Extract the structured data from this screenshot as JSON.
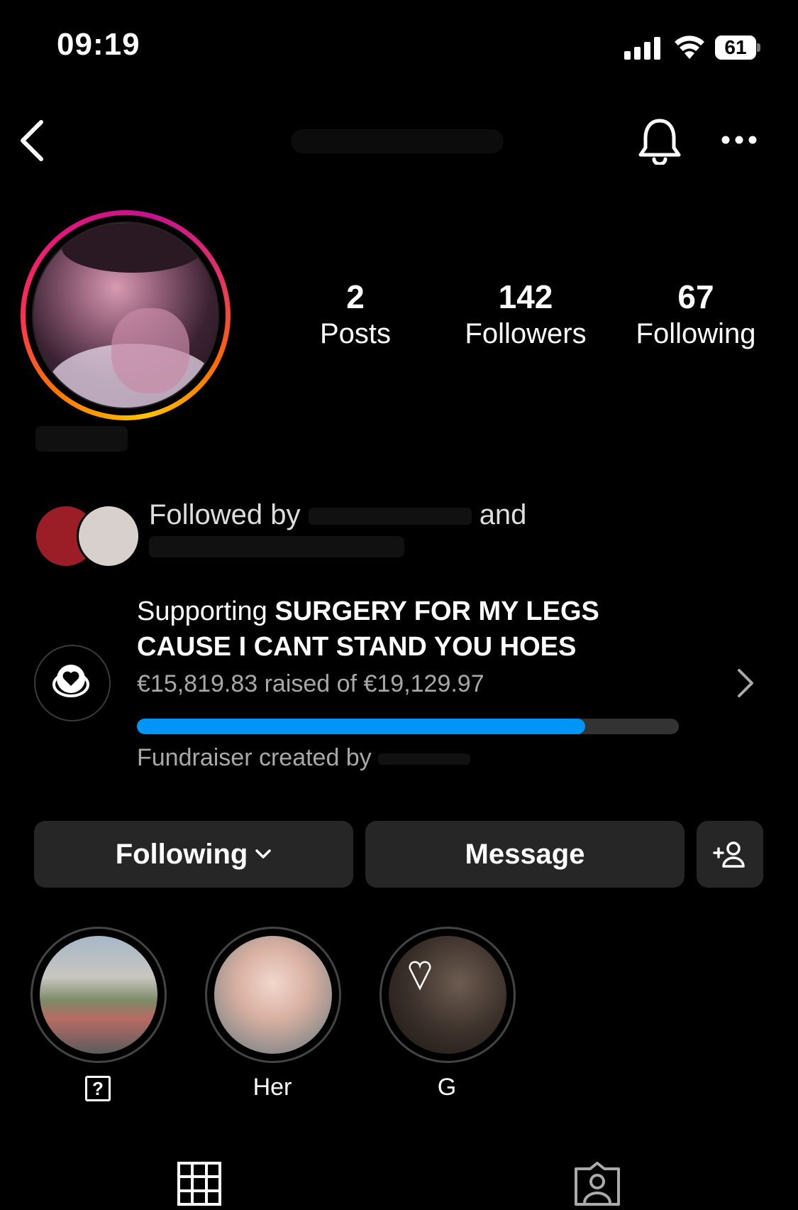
{
  "status_bar": {
    "time": "09:19",
    "battery": "61"
  },
  "header": {
    "icons": [
      "back-arrow-icon",
      "bell-icon",
      "more-options-icon"
    ]
  },
  "profile": {
    "stats": [
      {
        "value": "2",
        "label": "Posts"
      },
      {
        "value": "142",
        "label": "Followers"
      },
      {
        "value": "67",
        "label": "Following"
      }
    ],
    "followed_by_text": "Followed by",
    "followed_by_suffix": "and"
  },
  "fundraiser": {
    "prefix": "Supporting ",
    "title": "SURGERY FOR MY LEGS CAUSE I CANT STAND YOU HOES",
    "raised_text": "€15,819.83 raised of €19,129.97",
    "progress": 0.827,
    "created_by": "Fundraiser created by"
  },
  "actions": {
    "following_label": "Following",
    "message_label": "Message"
  },
  "highlights": [
    {
      "label": "?"
    },
    {
      "label": "Her"
    },
    {
      "label": "G"
    }
  ],
  "colors": {
    "background": "#000000",
    "button": "#262626",
    "progress_fill": "#0095f6",
    "progress_track": "#333333",
    "secondary_text": "#a8a8a8"
  }
}
